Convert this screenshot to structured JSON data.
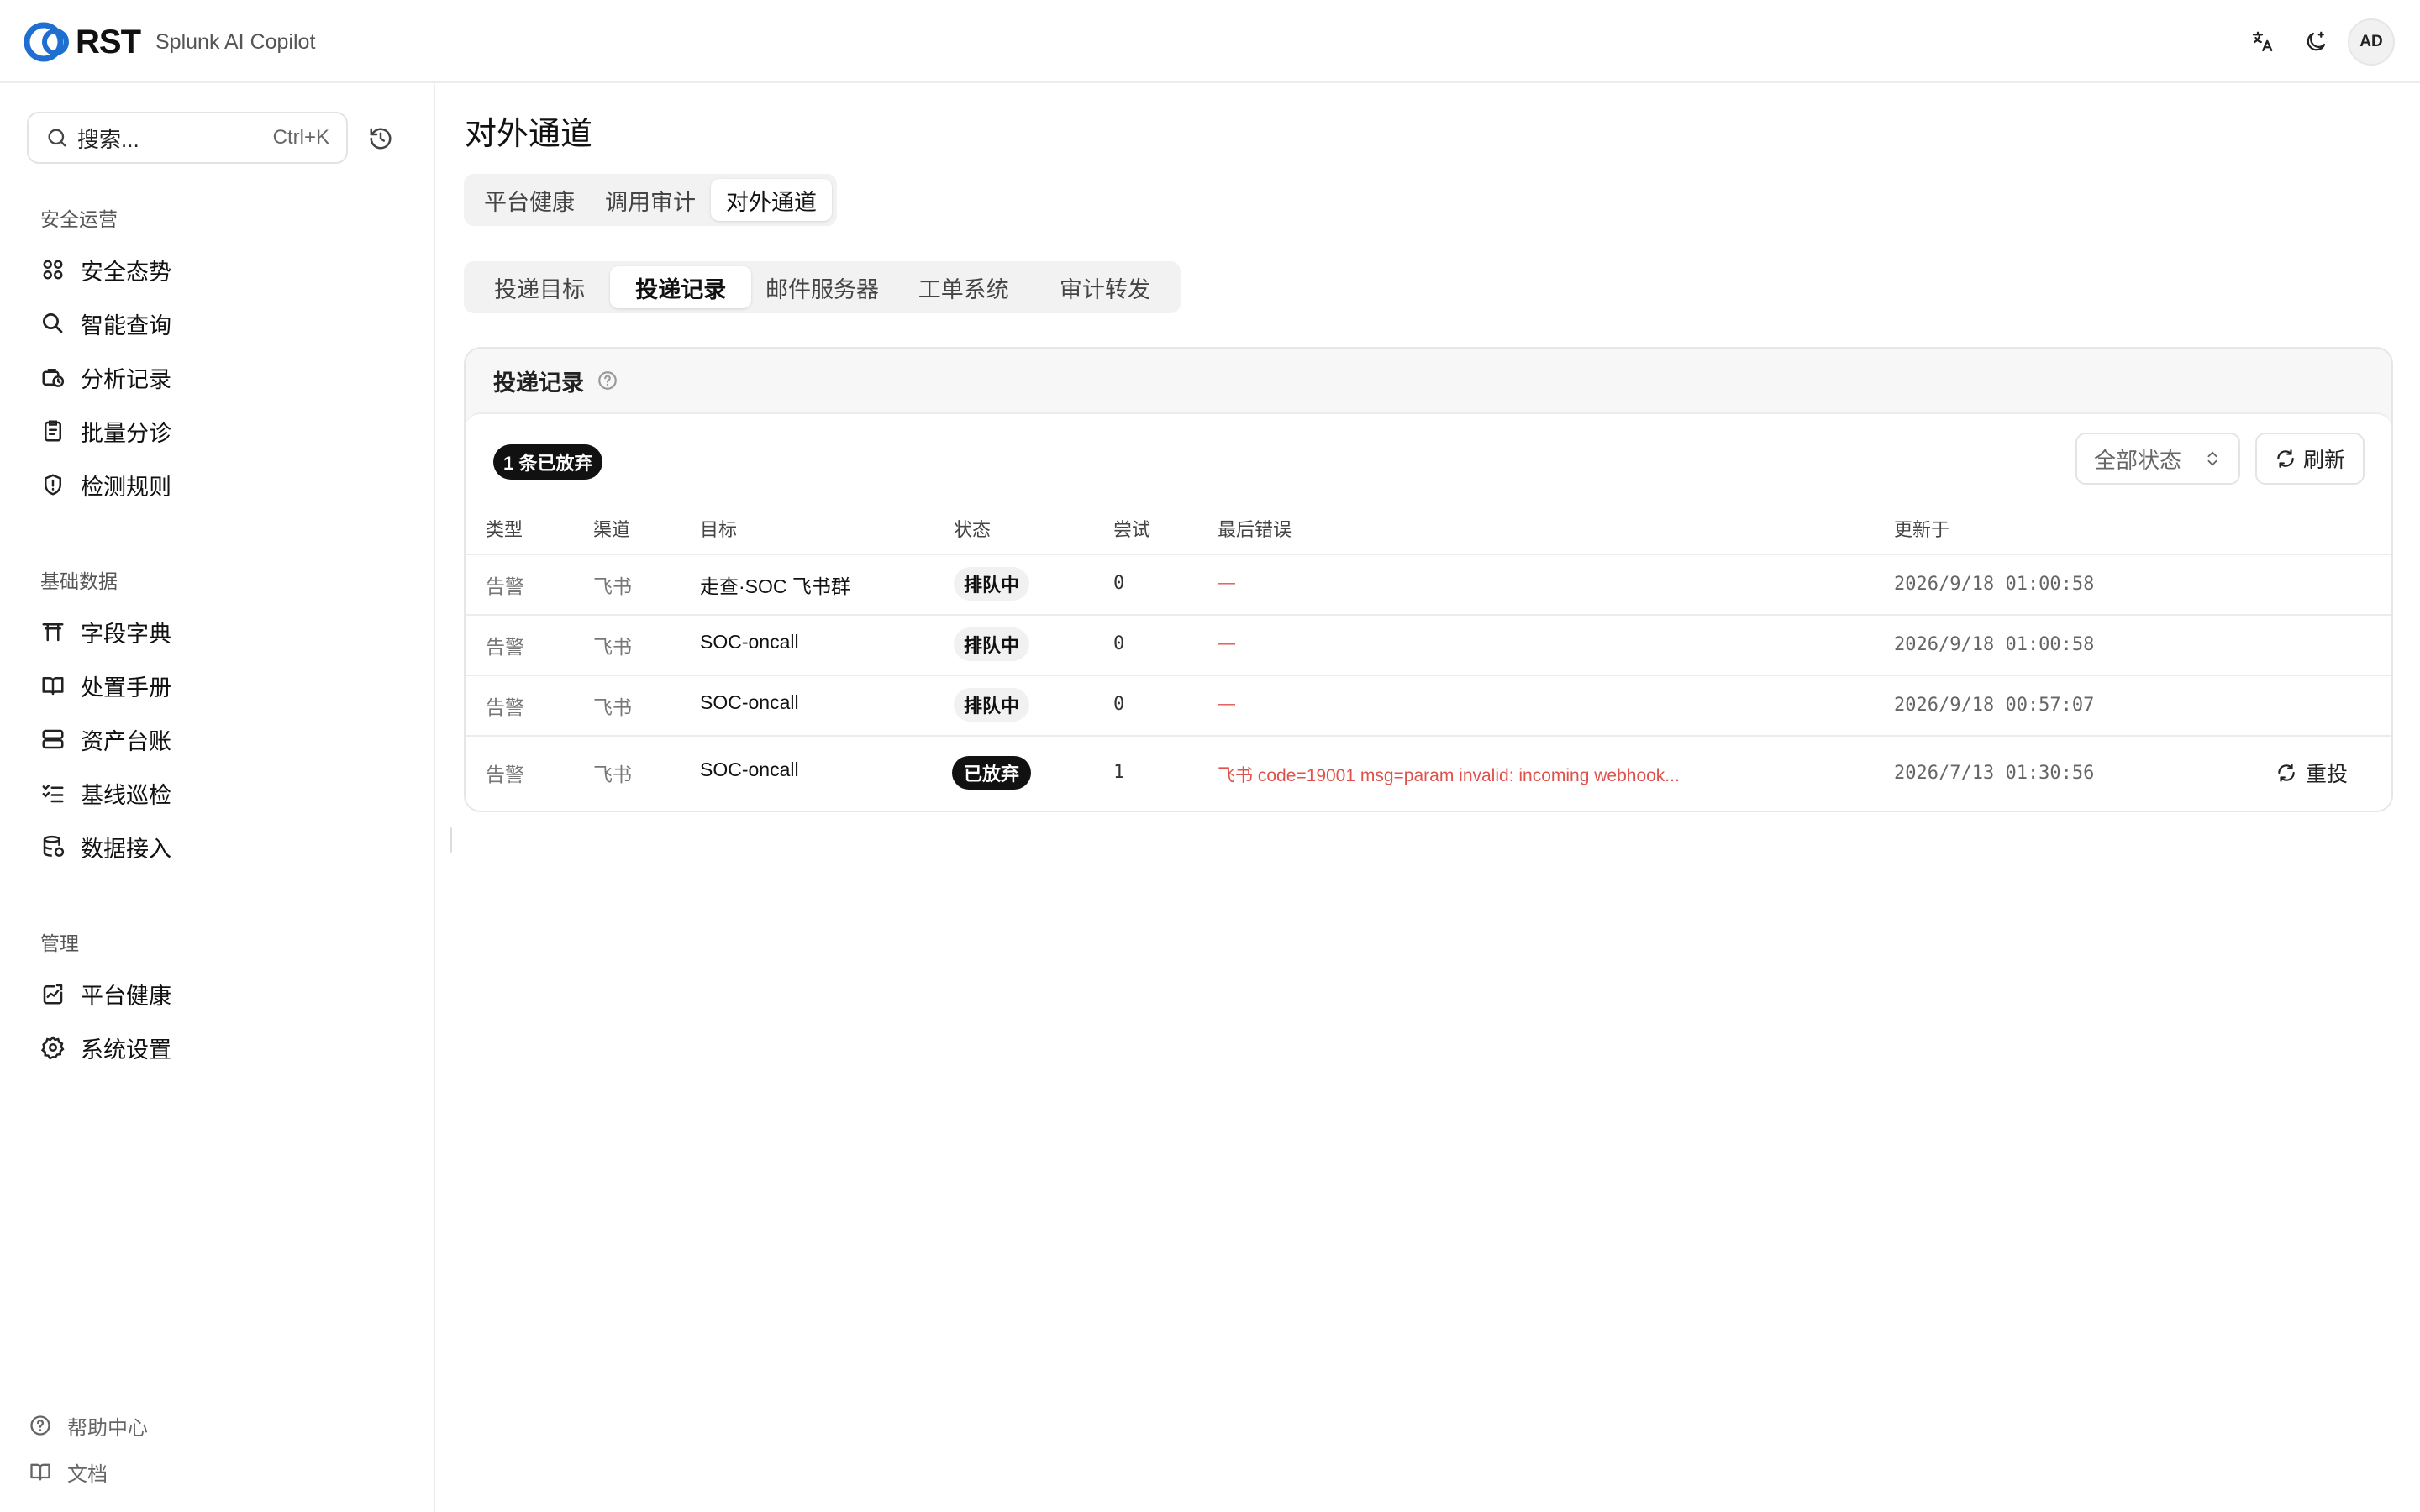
{
  "header": {
    "logo_text": "RST",
    "app_name": "Splunk AI Copilot",
    "avatar_initials": "AD",
    "icons": [
      "translate-icon",
      "theme-toggle-icon"
    ]
  },
  "sidebar": {
    "search": {
      "placeholder": "搜索...",
      "shortcut": "Ctrl+K"
    },
    "sections": [
      {
        "title": "安全运营",
        "items": [
          {
            "label": "安全态势",
            "icon": "dashboard-grid-icon"
          },
          {
            "label": "智能查询",
            "icon": "search-icon"
          },
          {
            "label": "分析记录",
            "icon": "briefcase-clock-icon"
          },
          {
            "label": "批量分诊",
            "icon": "clipboard-icon"
          },
          {
            "label": "检测规则",
            "icon": "shield-alert-icon"
          }
        ]
      },
      {
        "title": "基础数据",
        "items": [
          {
            "label": "字段字典",
            "icon": "torii-dictionary-icon"
          },
          {
            "label": "处置手册",
            "icon": "book-open-icon"
          },
          {
            "label": "资产台账",
            "icon": "server-icon"
          },
          {
            "label": "基线巡检",
            "icon": "list-check-icon"
          },
          {
            "label": "数据接入",
            "icon": "database-icon"
          }
        ]
      },
      {
        "title": "管理",
        "items": [
          {
            "label": "平台健康",
            "icon": "activity-chart-icon"
          },
          {
            "label": "系统设置",
            "icon": "gear-icon"
          }
        ]
      }
    ],
    "footer": [
      {
        "label": "帮助中心",
        "icon": "help-circle-icon"
      },
      {
        "label": "文档",
        "icon": "book-icon"
      }
    ]
  },
  "main": {
    "title": "对外通道",
    "tabs": [
      {
        "label": "平台健康",
        "active": false
      },
      {
        "label": "调用审计",
        "active": false
      },
      {
        "label": "对外通道",
        "active": true
      }
    ],
    "subtabs": [
      {
        "label": "投递目标",
        "active": false
      },
      {
        "label": "投递记录",
        "active": true
      },
      {
        "label": "邮件服务器",
        "active": false
      },
      {
        "label": "工单系统",
        "active": false
      },
      {
        "label": "审计转发",
        "active": false
      }
    ],
    "card": {
      "title": "投递记录",
      "abandoned_badge": "1 条已放弃",
      "status_filter": "全部状态",
      "refresh_label": "刷新",
      "columns": [
        "类型",
        "渠道",
        "目标",
        "状态",
        "尝试",
        "最后错误",
        "更新于"
      ],
      "rows": [
        {
          "type": "告警",
          "channel": "飞书",
          "target": "走查·SOC 飞书群",
          "status": "排队中",
          "status_kind": "queued",
          "attempts": "0",
          "last_error": "—",
          "updated": "2026/9/18 01:00:58"
        },
        {
          "type": "告警",
          "channel": "飞书",
          "target": "SOC-oncall",
          "status": "排队中",
          "status_kind": "queued",
          "attempts": "0",
          "last_error": "—",
          "updated": "2026/9/18 01:00:58"
        },
        {
          "type": "告警",
          "channel": "飞书",
          "target": "SOC-oncall",
          "status": "排队中",
          "status_kind": "queued",
          "attempts": "0",
          "last_error": "—",
          "updated": "2026/9/18 00:57:07"
        },
        {
          "type": "告警",
          "channel": "飞书",
          "target": "SOC-oncall",
          "status": "已放弃",
          "status_kind": "abandoned",
          "attempts": "1",
          "last_error": "飞书 code=19001 msg=param invalid: incoming webhook...",
          "updated": "2026/7/13 01:30:56",
          "action": "重投"
        }
      ]
    }
  },
  "colors": {
    "accent": "#1f6fd1",
    "error": "#e0514b",
    "dark_pill": "#111111"
  }
}
